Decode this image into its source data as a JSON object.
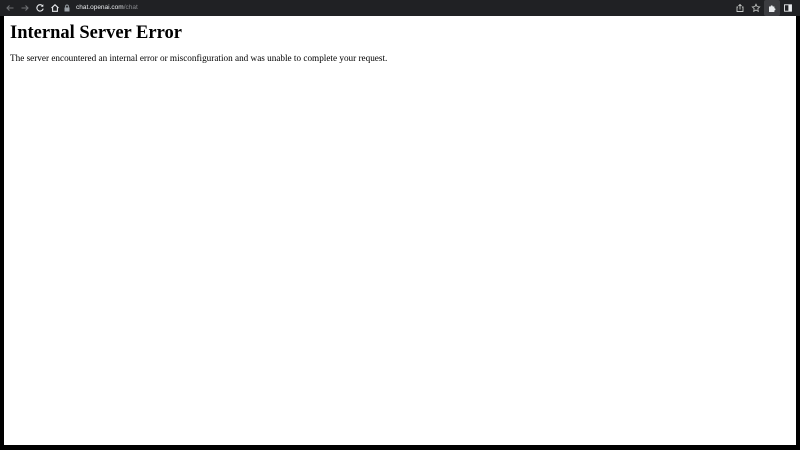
{
  "browser": {
    "url_host": "chat.openai.com",
    "url_path": "/chat",
    "icons": [
      "back-arrow-icon",
      "forward-arrow-icon",
      "reload-icon",
      "home-icon",
      "lock-icon",
      "share-icon",
      "bookmark-star-icon",
      "extensions-puzzle-icon",
      "side-panel-icon"
    ]
  },
  "page": {
    "heading": "Internal Server Error",
    "message": "The server encountered an internal error or misconfiguration and was unable to complete your request."
  },
  "colors": {
    "toolbar_bg": "#202124",
    "url_text": "#e8eaed",
    "url_path": "#8a8c90",
    "page_bg": "#ffffff",
    "frame_bg": "#000000"
  }
}
